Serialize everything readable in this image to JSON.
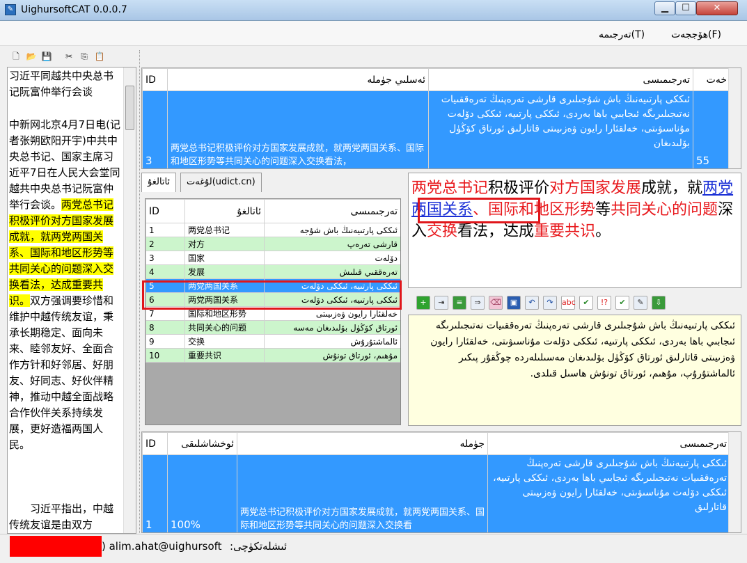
{
  "window": {
    "title": "UighursoftCAT 0.0.0.7"
  },
  "menu": {
    "file": "ھۆججەت(F)",
    "translate": "تەرجىمە(T)"
  },
  "left_text": {
    "p1": "习近平同越共中央总书记阮富仲举行会谈",
    "p2_before": "中新网北京4月7日电(记者张朔欧阳开宇)中共中央总书记、国家主席习近平7日在人民大会堂同越共中央总书记阮富仲举行会谈。",
    "p2_mark": "两党总书记积极评价对方国家发展成就，就两党两国关系、国际和地区形势等共同关心的问题深入交换看法，达成重要共识。",
    "p2_after": "双方强调要珍惜和维护中越传统友谊，秉承长期稳定、面向未来、睦邻友好、全面合作方针和好邻居、好朋友、好同志、好伙伴精神，推动中越全面战略合作伙伴关系持续发展，更好造福两国人民。",
    "p3": "习近平指出，中越传统友谊是由双方"
  },
  "top_table": {
    "headers": [
      "ID",
      "ئەسلىي جۈملە",
      "تەرجىمىسى",
      "خەت"
    ],
    "row": {
      "id": "3",
      "source": "两党总书记积极评价对方国家发展成就，就两党两国关系、国际和地区形势等共同关心的问题深入交换看法，",
      "target": "ئىككى پارتىيەنىڭ باش شۇجىلىرى قارشى تەرەپنىڭ تەرەققىيات نەتىجىلىرىگە ئىجابىي باھا بەردى، ئىككى پارتىيە، ئىككى دۆلەت مۇناسىۋىتى، خەلقئارا رايون ۋەزىيىتى قاتارلىق ئورتاق كۆڭۈل بۆلىدىغان",
      "chars": "55"
    }
  },
  "tabs": {
    "term": "ئاتالغۇ",
    "dict": "لۇغەت(udict.cn)"
  },
  "term_table": {
    "headers": [
      "ID",
      "ئاتالغۇ",
      "تەرجىمىسى"
    ],
    "rows": [
      {
        "id": "1",
        "term": "两党总书记",
        "trans": "ئىككى پارتىيەنىڭ باش شۇجە"
      },
      {
        "id": "2",
        "term": "对方",
        "trans": "قارشى تەرەپ"
      },
      {
        "id": "3",
        "term": "国家",
        "trans": "دۆلەت"
      },
      {
        "id": "4",
        "term": "发展",
        "trans": "تەرەققىي قىلىش"
      },
      {
        "id": "5",
        "term": "两党两国关系",
        "trans": "ئىككى پارتىيە، ئىككى دۆلەت"
      },
      {
        "id": "6",
        "term": "两党两国关系",
        "trans": "ئىككى پارتىيە، ئىككى دۆلەت"
      },
      {
        "id": "7",
        "term": "国际和地区形势",
        "trans": "خەلقئارا رايون ۋەزىيىتى"
      },
      {
        "id": "8",
        "term": "共同关心的问题",
        "trans": "ئورتاق كۆڭۈل بۆلىدىغان مەسە"
      },
      {
        "id": "9",
        "term": "交换",
        "trans": "ئالماشتۇرۇش"
      },
      {
        "id": "10",
        "term": "重要共识",
        "trans": "مۇھىم، ئورتاق تونۇش"
      }
    ]
  },
  "source": {
    "s1": "两党总书记",
    "s2": "积极评价",
    "s3": "对方国家发展",
    "s4": "成就，就",
    "s5": "两党两国关系",
    "s6": "、国际和地区形势",
    "s7": "等",
    "s8": "共同关心的问题",
    "s9": "深入",
    "s10": "交换",
    "s11": "看法，达成",
    "s12": "重要共识",
    "s13": "。"
  },
  "target_editor": "ئىككى پارتىيەنىڭ باش شۇجىلىرى قارشى تەرەپنىڭ تەرەققىيات نەتىجىلىرىگە ئىجابىي باھا بەردى، ئىككى پارتىيە، ئىككى دۆلەت مۇناسىۋىتى، خەلقئارا رايون ۋەزىيىتى قاتارلىق ئورتاق كۆڭۈل بۆلىدىغان مەسىلىلەردە چوڭقۇر پىكىر ئالماشتۇرۇپ، مۇھىم، ئورتاق تونۇش ھاسىل قىلدى.",
  "bottom_table": {
    "headers": [
      "ID",
      "ئوخشاشلىقى",
      "جۈملە",
      "تەرجىمىسى"
    ],
    "row": {
      "id": "1",
      "sim": "100%",
      "source": "两党总书记积极评价对方国家发展成就，就两党两国关系、国际和地区形势等共同关心的问题深入交换看",
      "target": "ئىككى پارتىيەنىڭ باش شۇجىلىرى قارشى تەرەپنىڭ تەرەققىيات نەتىجىلىرىگە ئىجابىي باھا بەردى، ئىككى پارتىيە، ئىككى دۆلەت مۇناسىۋىتى، خەلقئارا رايون ۋەزىيىتى قاتارلىق"
    }
  },
  "status": {
    "user": ") alim.ahat@uighursoft",
    "label": "ئىشلەتكۈچى:"
  },
  "colors": {
    "selection": "#3399ff",
    "term_green": "#ccf5cc",
    "highlight": "#ffff00",
    "red": "#e8181c"
  }
}
